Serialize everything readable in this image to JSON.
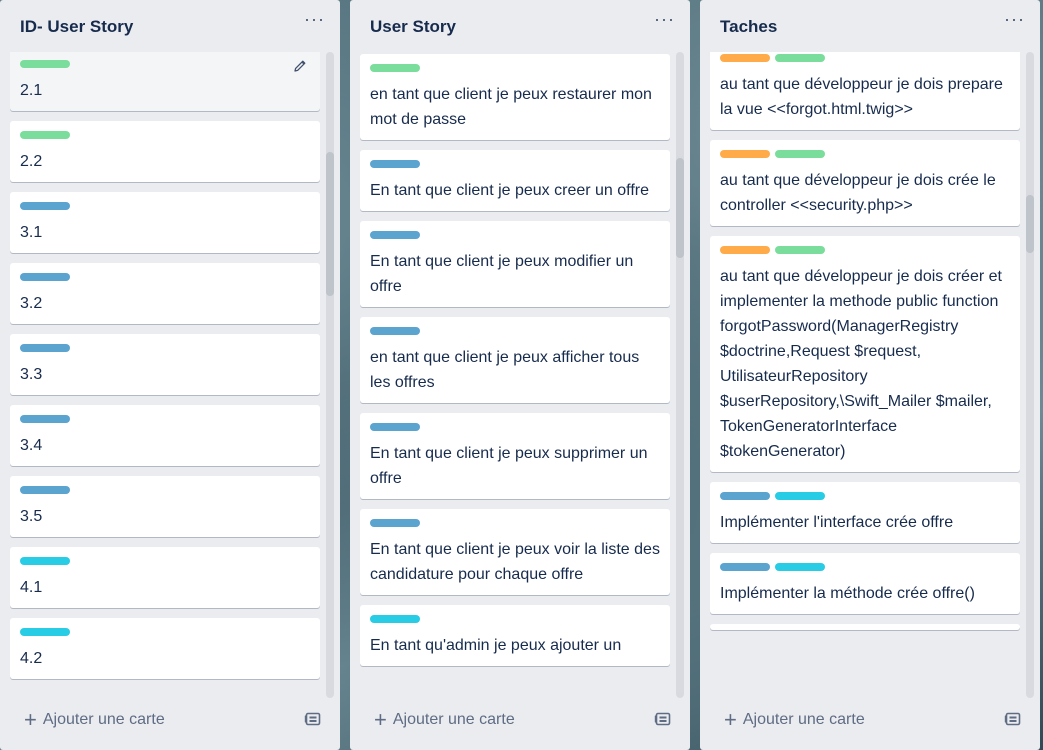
{
  "colors": {
    "green": "#7bdd9b",
    "blue": "#5ba4cf",
    "cyan": "#29cce5",
    "orange": "#ffab4a"
  },
  "lists": [
    {
      "title": "ID- User Story",
      "menu_label": "···",
      "add_card_label": "Ajouter une carte",
      "cards": [
        {
          "labels": [
            "green"
          ],
          "text": "2.1"
        },
        {
          "labels": [
            "green"
          ],
          "text": "2.2"
        },
        {
          "labels": [
            "blue"
          ],
          "text": "3.1"
        },
        {
          "labels": [
            "blue"
          ],
          "text": "3.2"
        },
        {
          "labels": [
            "blue"
          ],
          "text": "3.3"
        },
        {
          "labels": [
            "blue"
          ],
          "text": "3.4"
        },
        {
          "labels": [
            "blue"
          ],
          "text": "3.5"
        },
        {
          "labels": [
            "cyan"
          ],
          "text": "4.1"
        },
        {
          "labels": [
            "cyan"
          ],
          "text": "4.2"
        }
      ]
    },
    {
      "title": "User Story",
      "menu_label": "···",
      "add_card_label": "Ajouter une carte",
      "cards": [
        {
          "labels": [
            "green"
          ],
          "text": "en tant que client je peux restaurer mon mot de passe"
        },
        {
          "labels": [
            "blue"
          ],
          "text": "En tant que client je peux creer un offre"
        },
        {
          "labels": [
            "blue"
          ],
          "text": "En tant que client je peux modifier un offre"
        },
        {
          "labels": [
            "blue"
          ],
          "text": "en tant que client je peux afficher tous les offres"
        },
        {
          "labels": [
            "blue"
          ],
          "text": "En tant que client je peux supprimer un offre"
        },
        {
          "labels": [
            "blue"
          ],
          "text": "En tant que client je peux voir la liste des candidature pour chaque offre"
        },
        {
          "labels": [
            "cyan"
          ],
          "text": "En tant qu'admin je peux ajouter un"
        }
      ]
    },
    {
      "title": "Taches",
      "menu_label": "···",
      "add_card_label": "Ajouter une carte",
      "cards": [
        {
          "labels": [],
          "text": ""
        },
        {
          "labels": [
            "orange",
            "green"
          ],
          "text": "au tant que développeur je dois prepare la vue <<forgot.html.twig>>"
        },
        {
          "labels": [
            "orange",
            "green"
          ],
          "text": "au tant que développeur je dois crée le controller <<security.php>>"
        },
        {
          "labels": [
            "orange",
            "green"
          ],
          "text": "au tant que développeur je dois créer et implementer la methode public function forgotPassword(ManagerRegistry $doctrine,Request $request, UtilisateurRepository $userRepository,\\Swift_Mailer $mailer, TokenGeneratorInterface $tokenGenerator)"
        },
        {
          "labels": [
            "blue",
            "cyan"
          ],
          "text": "Implémenter l'interface crée offre"
        },
        {
          "labels": [
            "blue",
            "cyan"
          ],
          "text": "Implémenter la méthode crée offre()"
        },
        {
          "labels": [],
          "text": ""
        }
      ]
    }
  ]
}
